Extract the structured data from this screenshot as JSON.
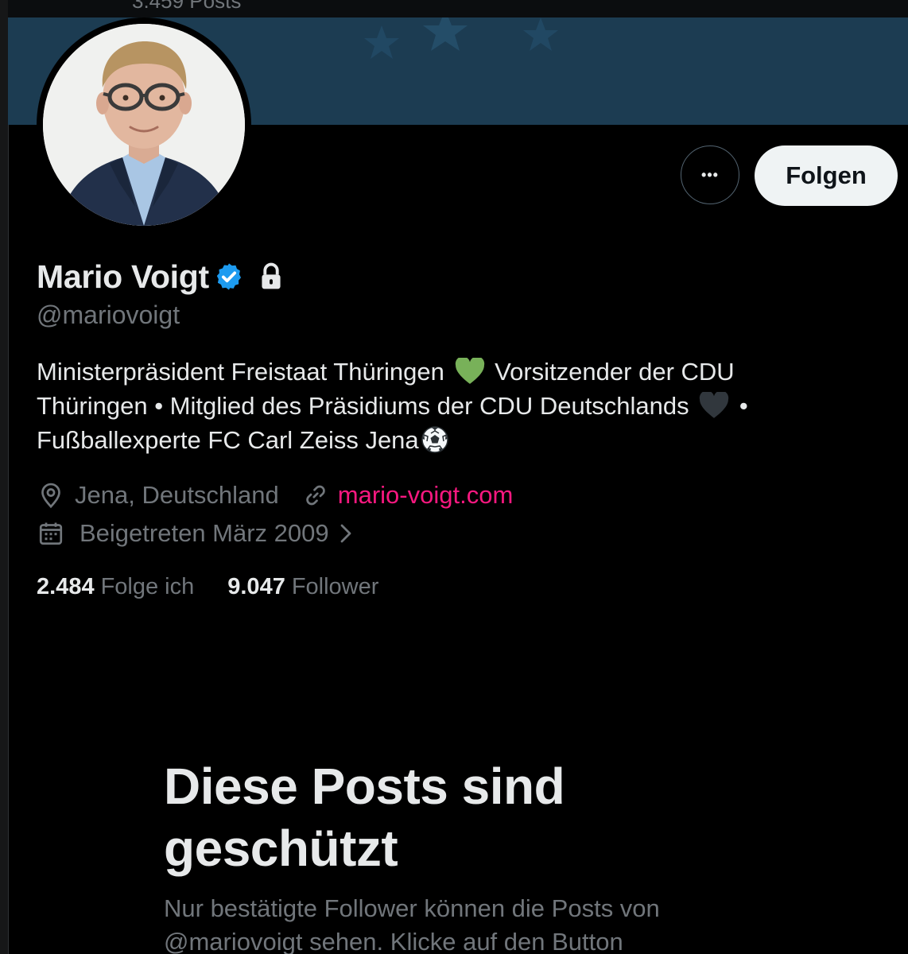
{
  "header": {
    "posts_count": "3.459 Posts"
  },
  "actions": {
    "more_label": "•••",
    "follow_label": "Folgen"
  },
  "profile": {
    "display_name": "Mario Voigt",
    "handle": "@mariovoigt",
    "bio": {
      "part1": "Ministerpräsident Freistaat Thüringen",
      "part2": "Vorsitzender der CDU Thüringen • Mitglied des Präsidiums der CDU Deutschlands",
      "part3": " • Fußballexperte FC Carl Zeiss Jena"
    },
    "location": "Jena, Deutschland",
    "website": "mario-voigt.com",
    "joined": "Beigetreten März 2009"
  },
  "stats": {
    "following_count": "2.484",
    "following_label": "Folge ich",
    "followers_count": "9.047",
    "followers_label": "Follower"
  },
  "protected": {
    "title": "Diese Posts sind geschützt",
    "text": "Nur bestätigte Follower können die Posts von @mariovoigt sehen. Klicke auf den Button"
  },
  "colors": {
    "background": "#000000",
    "banner": "#1c3c52",
    "link": "#f91880",
    "verified": "#1d9bf0",
    "muted": "#71767b",
    "heart_green": "#78b159",
    "heart_black": "#31373d"
  },
  "icons": {
    "verified": "verified-badge-icon",
    "lock": "lock-icon",
    "location": "location-pin-icon",
    "link": "link-icon",
    "calendar": "calendar-icon",
    "chevron": "chevron-right-icon",
    "green_heart": "green-heart-emoji",
    "black_heart": "black-heart-emoji",
    "soccer_ball": "soccer-ball-emoji"
  }
}
